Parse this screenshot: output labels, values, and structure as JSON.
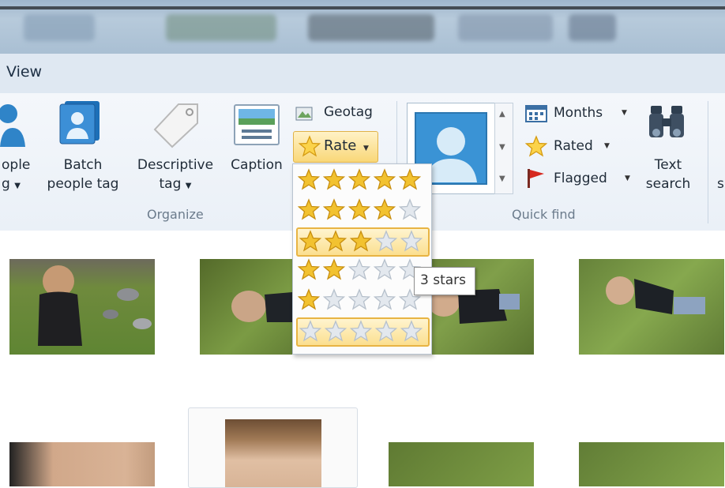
{
  "tabs": {
    "view": "View"
  },
  "ribbon": {
    "people_tag_label_line1": "ople",
    "people_tag_label_line2": "g",
    "batch_label_line1": "Batch",
    "batch_label_line2": "people tag",
    "descriptive_label_line1": "Descriptive",
    "descriptive_label_line2": "tag",
    "caption_label": "Caption",
    "geotag_label": "Geotag",
    "rate_label": "Rate",
    "organize_group": "Organize",
    "months_label": "Months",
    "rated_label": "Rated",
    "flagged_label": "Flagged",
    "text_search_line1": "Text",
    "text_search_line2": "search",
    "quick_find_group": "Quick find",
    "partial_right": "s"
  },
  "rate_menu": {
    "options": [
      {
        "stars": 5
      },
      {
        "stars": 4
      },
      {
        "stars": 3,
        "highlighted": true
      },
      {
        "stars": 2
      },
      {
        "stars": 1
      },
      {
        "stars": 0,
        "selected": true
      }
    ],
    "tooltip": "3 stars"
  },
  "icons": {
    "geotag": "map-icon",
    "rate": "star-icon",
    "months": "calendar-icon",
    "rated": "star-icon",
    "flagged": "flag-icon",
    "text_search": "binoculars-icon"
  },
  "colors": {
    "accent": "#f9d778",
    "star_fill": "#f2c230",
    "star_empty": "#e3e8ee"
  }
}
